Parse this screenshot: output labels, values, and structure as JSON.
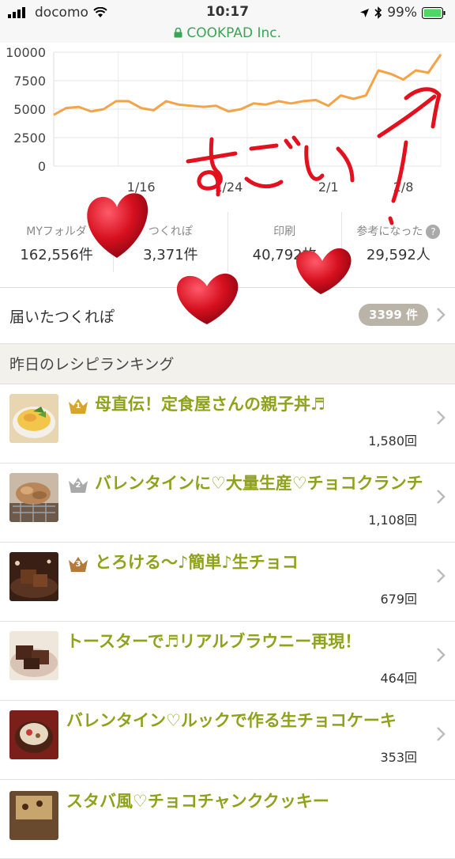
{
  "status_bar": {
    "carrier": "docomo",
    "time": "10:17",
    "battery": "99%"
  },
  "browser": {
    "url_label": "COOKPAD Inc."
  },
  "chart_data": {
    "type": "line",
    "title": "",
    "xlabel": "",
    "ylabel": "",
    "y_ticks": [
      "10000",
      "7500",
      "5000",
      "2500",
      "0"
    ],
    "ylim": [
      0,
      10000
    ],
    "x_ticks": [
      "1/16",
      "1/24",
      "2/1",
      "2/8"
    ],
    "grid": true,
    "color": "#f5a347",
    "series": [
      {
        "values": [
          4500,
          5100,
          5200,
          4800,
          5000,
          5700,
          5700,
          5100,
          4900,
          5700,
          5400,
          5300,
          5200,
          5300,
          4800,
          5000,
          5500,
          5400,
          5700,
          5500,
          5700,
          5800,
          5300,
          6200,
          5900,
          6200,
          8400,
          8100,
          7600,
          8400,
          8200,
          9800
        ]
      }
    ]
  },
  "stats": [
    {
      "label": "MYフォルダ",
      "value": "162,556件"
    },
    {
      "label": "つくれぽ",
      "value": "3,371件"
    },
    {
      "label": "印刷",
      "value": "40,792枚"
    },
    {
      "label": "参考になった",
      "value": "29,592人"
    }
  ],
  "tsukurepo": {
    "label": "届いたつくれぽ",
    "count": "3399 件"
  },
  "ranking": {
    "section_title": "昨日のレシピランキング",
    "items": [
      {
        "rank": "1",
        "title": "母直伝！定食屋さんの親子丼♬",
        "count": "1,580回"
      },
      {
        "rank": "2",
        "title": "バレンタインに♡大量生産♡チョコクランチ",
        "count": "1,108回"
      },
      {
        "rank": "3",
        "title": "とろける〜♪簡単♪生チョコ",
        "count": "679回"
      },
      {
        "rank": "",
        "title": "トースターで♬リアルブラウニー再現！",
        "count": "464回"
      },
      {
        "rank": "",
        "title": "バレンタイン♡ルックで作る生チョコケーキ",
        "count": "353回"
      },
      {
        "rank": "",
        "title": "スタバ風♡チョコチャンククッキー",
        "count": ""
      }
    ]
  },
  "annotation": {
    "handwriting": "すごい！"
  }
}
